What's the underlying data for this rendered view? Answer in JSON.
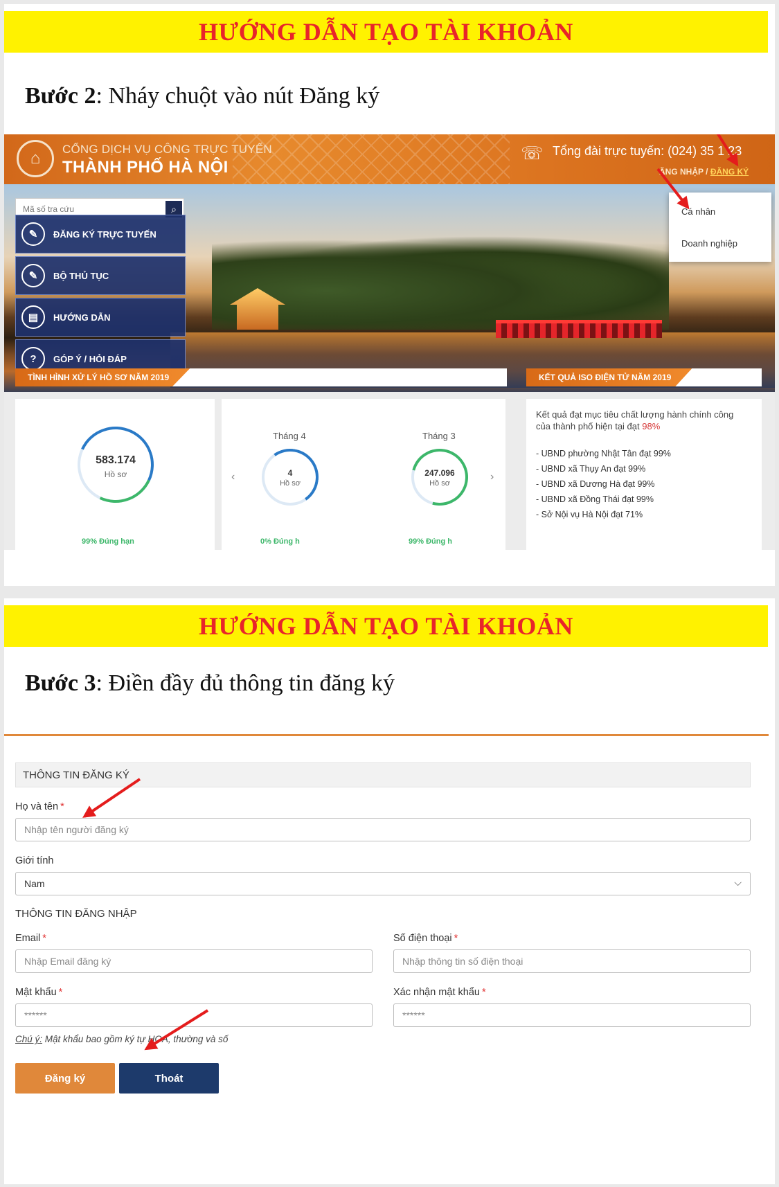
{
  "step2": {
    "banner": "HƯỚNG DẪN TẠO TÀI KHOẢN",
    "step_label": "Bước 2",
    "step_text": ": Nháy chuột vào nút Đăng ký",
    "portal": {
      "brand_line1": "CỔNG DỊCH VỤ CÔNG TRỰC TUYẾN",
      "brand_line2": "THÀNH PHỐ HÀ NỘI",
      "hotline": "Tổng đài trực tuyến: (024) 35 1 23",
      "login_link": "ĂNG NHẬP",
      "separator": "/",
      "register_link": "ĐĂNG KÝ",
      "search_placeholder": "Mã số tra cứu",
      "nav": [
        {
          "label": "ĐĂNG KÝ TRỰC TUYẾN",
          "icon": "edit-icon"
        },
        {
          "label": "BỘ THỦ TỤC",
          "icon": "edit-icon"
        },
        {
          "label": "HƯỚNG DẪN",
          "icon": "document-icon"
        },
        {
          "label": "GÓP Ý / HỎI ĐÁP",
          "icon": "question-icon"
        }
      ],
      "dropdown": [
        "Cá nhân",
        "Doanh nghiệp"
      ],
      "ribbon_left": "TÌNH HÌNH XỬ LÝ HỒ SƠ NĂM 2019",
      "ribbon_right": "KẾT QUẢ ISO ĐIỆN TỬ NĂM 2019",
      "total": {
        "value": "583.174",
        "unit": "Hồ sơ",
        "cut_text": "99% Đúng hạn"
      },
      "months": [
        {
          "label": "Tháng 4",
          "value": "4",
          "unit": "Hồ sơ",
          "cut_text": "0% Đúng h"
        },
        {
          "label": "Tháng 3",
          "value": "247.096",
          "unit": "Hồ sơ",
          "cut_text": "99% Đúng h"
        }
      ],
      "prev": "‹",
      "next": "›",
      "iso_intro": "Kết quả đạt mục tiêu chất lượng hành chính công của thành phố hiện tại đạt",
      "iso_pct": "98%",
      "iso_items": [
        "- UBND phường Nhật Tân đạt 99%",
        "- UBND xã Thụy An đạt 99%",
        "- UBND xã Dương Hà đạt 99%",
        "- UBND xã Đồng Thái đạt 99%",
        "- Sở Nội vụ Hà Nội đạt 71%"
      ]
    }
  },
  "step3": {
    "banner": "HƯỚNG DẪN TẠO TÀI KHOẢN",
    "step_label": "Bước 3",
    "step_text": ": Điền đầy đủ thông tin đăng ký",
    "form": {
      "section_title": "THÔNG TIN ĐĂNG KÝ",
      "name_label": "Họ và tên",
      "name_placeholder": "Nhập tên người đăng ký",
      "gender_label": "Giới tính",
      "gender_value": "Nam",
      "login_section": "THÔNG TIN ĐĂNG NHẬP",
      "email_label": "Email",
      "email_placeholder": "Nhập Email đăng ký",
      "phone_label": "Số điện thoại",
      "phone_placeholder": "Nhập thông tin số điện thoại",
      "password_label": "Mật khẩu",
      "password_placeholder": "******",
      "confirm_label": "Xác nhận mật khẩu",
      "confirm_placeholder": "******",
      "required_mark": "*",
      "note_prefix": "Chú ý:",
      "note_text": " Mật khẩu bao gồm ký tự HOA, thường và số",
      "submit_label": "Đăng ký",
      "exit_label": "Thoát"
    }
  },
  "colors": {
    "banner_bg": "#fff200",
    "banner_text": "#e8242a",
    "portal_orange": "#e0883a",
    "navy": "#1d3a6b",
    "arrow": "#e41c1c"
  }
}
